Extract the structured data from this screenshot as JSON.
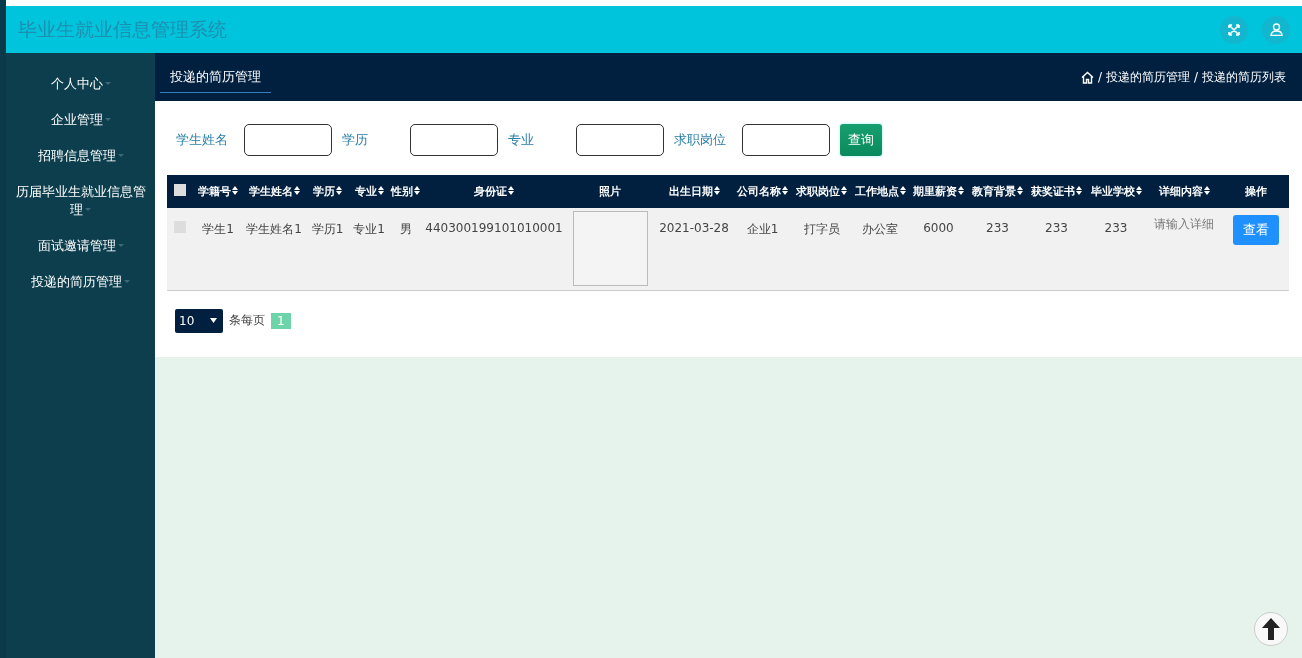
{
  "header": {
    "title": "毕业生就业信息管理系统"
  },
  "sidebar": {
    "items": [
      {
        "label": "个人中心",
        "has_submenu": true
      },
      {
        "label": "企业管理",
        "has_submenu": true
      },
      {
        "label": "招聘信息管理",
        "has_submenu": true
      },
      {
        "label": "历届毕业生就业信息管理",
        "has_submenu": true
      },
      {
        "label": "面试邀请管理",
        "has_submenu": true
      },
      {
        "label": "投递的简历管理",
        "has_submenu": true
      }
    ]
  },
  "tabs": [
    {
      "label": "投递的简历管理",
      "selected": true
    }
  ],
  "breadcrumb": {
    "separator": "/",
    "items": [
      "投递的简历管理",
      "投递的简历列表"
    ]
  },
  "search": {
    "fields": [
      {
        "label": "学生姓名"
      },
      {
        "label": "学历"
      },
      {
        "label": "专业"
      },
      {
        "label": "求职岗位"
      }
    ],
    "button": "查询"
  },
  "table": {
    "all_selected": false,
    "columns": [
      {
        "label": "学籍号",
        "sortable": true
      },
      {
        "label": "学生姓名",
        "sortable": true
      },
      {
        "label": "学历",
        "sortable": true
      },
      {
        "label": "专业",
        "sortable": true
      },
      {
        "label": "性别",
        "sortable": true
      },
      {
        "label": "身份证",
        "sortable": true
      },
      {
        "label": "照片",
        "sortable": false
      },
      {
        "label": "出生日期",
        "sortable": true
      },
      {
        "label": "公司名称",
        "sortable": true
      },
      {
        "label": "求职岗位",
        "sortable": true
      },
      {
        "label": "工作地点",
        "sortable": true
      },
      {
        "label": "期里薪资",
        "sortable": true
      },
      {
        "label": "教育背景",
        "sortable": true
      },
      {
        "label": "获奖证书",
        "sortable": true
      },
      {
        "label": "毕业学校",
        "sortable": true
      },
      {
        "label": "详细内容",
        "sortable": true
      },
      {
        "label": "操作",
        "sortable": false
      }
    ],
    "rows": [
      {
        "selected": false,
        "cells": [
          {
            "kind": "text",
            "text": "学生1"
          },
          {
            "kind": "text",
            "text": "学生姓名1"
          },
          {
            "kind": "text",
            "text": "学历1"
          },
          {
            "kind": "text",
            "text": "专业1"
          },
          {
            "kind": "text",
            "text": "男"
          },
          {
            "kind": "text",
            "text": "440300199101010001"
          },
          {
            "kind": "photo"
          },
          {
            "kind": "text",
            "text": "2021-03-28"
          },
          {
            "kind": "text",
            "text": "企业1"
          },
          {
            "kind": "text",
            "text": "打字员"
          },
          {
            "kind": "text",
            "text": "办公室"
          },
          {
            "kind": "text",
            "text": "6000"
          },
          {
            "kind": "text",
            "text": "233"
          },
          {
            "kind": "text",
            "text": "233"
          },
          {
            "kind": "text",
            "text": "233"
          },
          {
            "kind": "note",
            "text": "请输入详细"
          },
          {
            "kind": "button",
            "text": "查看"
          }
        ]
      }
    ]
  },
  "pagination": {
    "page_size": "10",
    "per_page_label": "条每页",
    "pages": [
      {
        "label": "1",
        "selected": true
      }
    ]
  }
}
